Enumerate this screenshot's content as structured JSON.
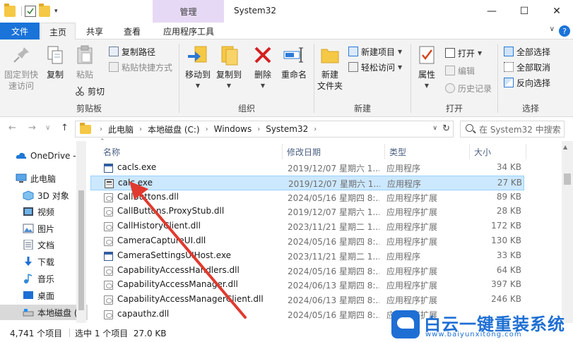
{
  "titlebar": {
    "context_tab": "管理",
    "title": "System32",
    "minimize": "—",
    "maximize": "☐",
    "close": "✕"
  },
  "ribbon_tabs": {
    "file": "文件",
    "home": "主页",
    "share": "共享",
    "view": "查看",
    "app_tools": "应用程序工具",
    "help": "?"
  },
  "ribbon": {
    "clipboard": {
      "pin": "固定到快",
      "pin2": "速访问",
      "copy": "复制",
      "paste": "粘贴",
      "copy_path": "复制路径",
      "paste_shortcut": "粘贴快捷方式",
      "cut": "剪切",
      "group": "剪贴板"
    },
    "organize": {
      "move_to": "移动到",
      "copy_to": "复制到",
      "delete": "删除",
      "rename": "重命名",
      "group": "组织"
    },
    "new": {
      "new_folder": "新建",
      "new_folder2": "文件夹",
      "new_item": "新建项目",
      "easy_access": "轻松访问",
      "group": "新建"
    },
    "open": {
      "properties": "属性",
      "open": "打开",
      "edit": "编辑",
      "history": "历史记录",
      "group": "打开"
    },
    "select": {
      "select_all": "全部选择",
      "select_none": "全部取消",
      "invert": "反向选择",
      "group": "选择"
    }
  },
  "address": {
    "back": "←",
    "forward": "→",
    "recent": "∨",
    "up": "↑",
    "crumbs": [
      "此电脑",
      "本地磁盘 (C:)",
      "Windows",
      "System32"
    ],
    "search_placeholder": "在 System32 中搜索"
  },
  "navpane": {
    "items": [
      "OneDrive - ...",
      "此电脑",
      "3D 对象",
      "视频",
      "图片",
      "文档",
      "下载",
      "音乐",
      "桌面",
      "本地磁盘 ("
    ]
  },
  "columns": {
    "name": "名称",
    "date": "修改日期",
    "type": "类型",
    "size": "大小"
  },
  "files": [
    {
      "name": "cacls.exe",
      "date": "2019/12/07 星期六 1...",
      "type": "应用程序",
      "size": "34 KB",
      "icon": "exe"
    },
    {
      "name": "calc.exe",
      "date": "2019/12/07 星期六 1...",
      "type": "应用程序",
      "size": "27 KB",
      "icon": "calc"
    },
    {
      "name": "CallButtons.dll",
      "date": "2024/05/16 星期四 8:...",
      "type": "应用程序扩展",
      "size": "89 KB",
      "icon": "dll"
    },
    {
      "name": "CallButtons.ProxyStub.dll",
      "date": "2019/12/07 星期六 1...",
      "type": "应用程序扩展",
      "size": "28 KB",
      "icon": "dll"
    },
    {
      "name": "CallHistoryClient.dll",
      "date": "2023/11/21 星期二 1...",
      "type": "应用程序扩展",
      "size": "172 KB",
      "icon": "dll"
    },
    {
      "name": "CameraCaptureUI.dll",
      "date": "2024/05/16 星期四 8:...",
      "type": "应用程序扩展",
      "size": "130 KB",
      "icon": "dll"
    },
    {
      "name": "CameraSettingsUIHost.exe",
      "date": "2023/11/21 星期二 1...",
      "type": "应用程序",
      "size": "33 KB",
      "icon": "exe"
    },
    {
      "name": "CapabilityAccessHandlers.dll",
      "date": "2024/05/16 星期四 8:...",
      "type": "应用程序扩展",
      "size": "64 KB",
      "icon": "dll"
    },
    {
      "name": "CapabilityAccessManager.dll",
      "date": "2024/06/13 星期四 8:...",
      "type": "应用程序扩展",
      "size": "397 KB",
      "icon": "dll"
    },
    {
      "name": "CapabilityAccessManagerClient.dll",
      "date": "2024/06/13 星期四 8:...",
      "type": "应用程序扩展",
      "size": "246 KB",
      "icon": "dll"
    },
    {
      "name": "capauthz.dll",
      "date": "2024/05/16 星期四 8:...",
      "type": "应用程序扩展",
      "size": "",
      "icon": "dll"
    }
  ],
  "selected_index": 1,
  "status": {
    "count": "4,741 个项目",
    "selection": "选中 1 个项目  27.0 KB"
  },
  "watermark": {
    "title": "白云一键重装系统",
    "url": "www.baiyunxitong.com"
  },
  "colors": {
    "accent": "#1a73d9",
    "context_tab": "#e6d9f5",
    "selected_row": "#cce8ff",
    "annotation_arrow": "#e03a2f"
  }
}
